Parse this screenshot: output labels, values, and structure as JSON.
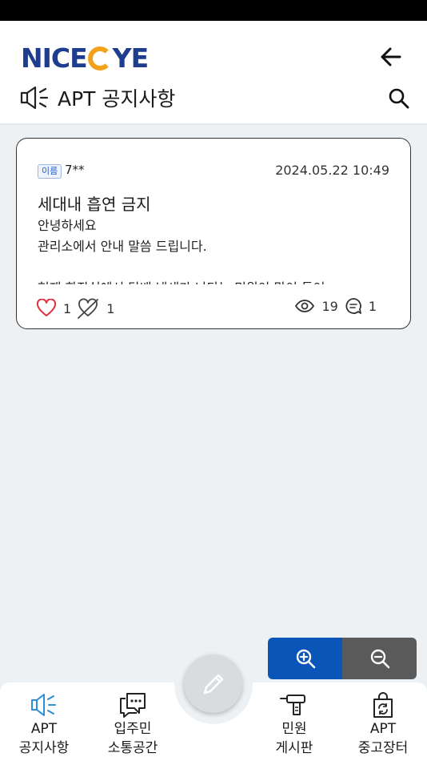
{
  "header": {
    "logo_pre": "NICE",
    "logo_post": "YE",
    "title": "APT 공지사항"
  },
  "post": {
    "badge": "이름",
    "author": "7**",
    "date": "2024.05.22 10:49",
    "subject": "세대내 흡연 금지",
    "body_lines": [
      "안녕하세요",
      "관리소에서 안내 말씀 드립니다.",
      "",
      "현재 화장실에서 담배 냄새가 난다는 민원이 많이 들어"
    ],
    "likes": "1",
    "dislikes": "1",
    "views": "19",
    "comments": "1"
  },
  "nav": {
    "items": [
      {
        "line1": "APT",
        "line2": "공지사항"
      },
      {
        "line1": "입주민",
        "line2": "소통공간"
      },
      {
        "line1": "민원",
        "line2": "게시판"
      },
      {
        "line1": "APT",
        "line2": "중고장터"
      }
    ]
  },
  "colors": {
    "brand": "#1e3d8f",
    "logo_accent": "#f2a21a",
    "zoom_in": "#0a55b8",
    "zoom_out": "#5a5a5a",
    "like": "#e03040",
    "nav_active": "#2a8fd6"
  }
}
